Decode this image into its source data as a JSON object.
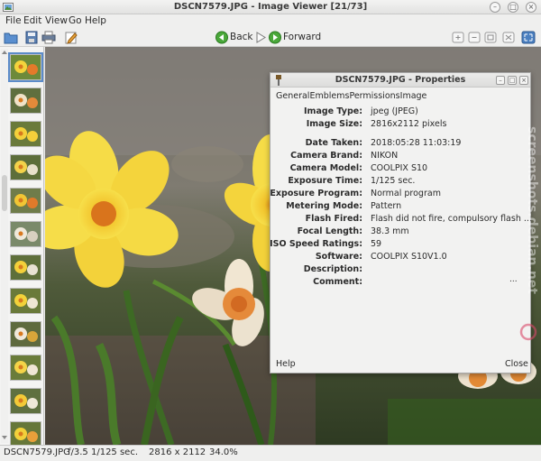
{
  "window": {
    "title": "DSCN7579.JPG - Image Viewer [21/73]"
  },
  "menu": [
    "File",
    "Edit",
    "View",
    "Go",
    "Help"
  ],
  "toolbar": {
    "back_label": "Back",
    "forward_label": "Forward"
  },
  "dialog": {
    "title": "DSCN7579.JPG - Properties",
    "tabs": [
      "General",
      "Emblems",
      "Permissions",
      "Image"
    ],
    "properties": [
      {
        "label": "Image Type:",
        "value": "jpeg (JPEG)"
      },
      {
        "label": "Image Size:",
        "value": "2816x2112 pixels"
      },
      {
        "label": "Date Taken:",
        "value": "2018:05:28 11:03:19"
      },
      {
        "label": "Camera Brand:",
        "value": "NIKON"
      },
      {
        "label": "Camera Model:",
        "value": "COOLPIX S10"
      },
      {
        "label": "Exposure Time:",
        "value": "1/125 sec."
      },
      {
        "label": "Exposure Program:",
        "value": "Normal program"
      },
      {
        "label": "Metering Mode:",
        "value": "Pattern"
      },
      {
        "label": "Flash Fired:",
        "value": "Flash did not fire, compulsory flash ..."
      },
      {
        "label": "Focal Length:",
        "value": "38.3 mm"
      },
      {
        "label": "ISO Speed Ratings:",
        "value": "59"
      },
      {
        "label": "Software:",
        "value": "COOLPIX S10V1.0"
      },
      {
        "label": "Description:",
        "value": ""
      },
      {
        "label": "Comment:",
        "value": ""
      }
    ],
    "comment_more": "...",
    "help_label": "Help",
    "close_label": "Close"
  },
  "status": {
    "filename": "DSCN7579.JPG",
    "exposure": "f/3.5  1/125 sec.",
    "dimensions": "2816 x 2112",
    "zoom": "34.0%"
  },
  "watermark": "screenshots.debian.net",
  "colors": {
    "selection": "#5b8bc9",
    "accent_green": "#3a9a2a"
  }
}
